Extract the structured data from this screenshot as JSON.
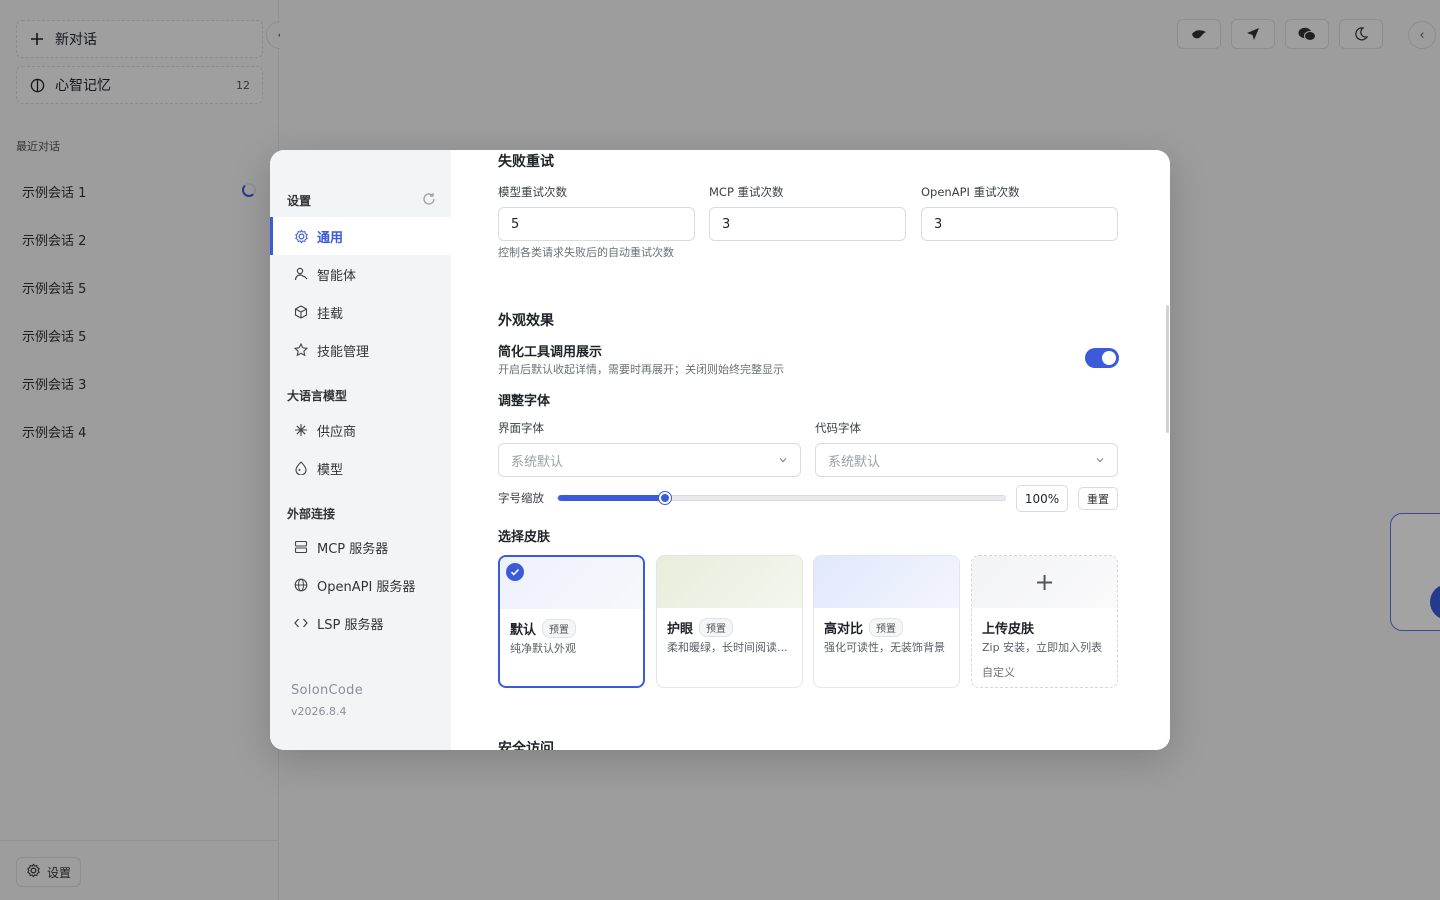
{
  "sidebar": {
    "new_chat": "新对话",
    "memory": "心智记忆",
    "memory_count": "12",
    "recent_title": "最近对话",
    "conversations": [
      "示例会话 1",
      "示例会话 2",
      "示例会话 5",
      "示例会话 5",
      "示例会话 3",
      "示例会话 4"
    ],
    "settings_label": "设置"
  },
  "modal": {
    "nav": {
      "settings_section": "设置",
      "items_general": [
        "通用",
        "智能体",
        "挂载",
        "技能管理"
      ],
      "llm_section": "大语言模型",
      "items_llm": [
        "供应商",
        "模型"
      ],
      "external_section": "外部连接",
      "items_external": [
        "MCP 服务器",
        "OpenAPI 服务器",
        "LSP 服务器"
      ],
      "brand": "SolonCode",
      "version": "v2026.8.4"
    },
    "retry": {
      "title": "失败重试",
      "model_label": "模型重试次数",
      "model_value": "5",
      "mcp_label": "MCP 重试次数",
      "mcp_value": "3",
      "openapi_label": "OpenAPI 重试次数",
      "openapi_value": "3",
      "hint": "控制各类请求失败后的自动重试次数"
    },
    "appearance": {
      "title": "外观效果",
      "simplify_label": "简化工具调用展示",
      "simplify_hint": "开启后默认收起详情，需要时再展开；关闭则始终完整显示",
      "simplify_on": true,
      "font_title": "调整字体",
      "ui_font_label": "界面字体",
      "ui_font_value": "系统默认",
      "code_font_label": "代码字体",
      "code_font_value": "系统默认",
      "scale_label": "字号缩放",
      "scale_value": "100%",
      "scale_fraction": 0.24,
      "reset_label": "重置"
    },
    "skins": {
      "title": "选择皮肤",
      "items": [
        {
          "name": "默认",
          "tag": "预置",
          "desc": "纯净默认外观",
          "selected": true
        },
        {
          "name": "护眼",
          "tag": "预置",
          "desc": "柔和暖绿，长时间阅读..."
        },
        {
          "name": "高对比",
          "tag": "预置",
          "desc": "强化可读性，无装饰背景"
        }
      ],
      "upload": {
        "name": "上传皮肤",
        "desc": "Zip 安装，立即加入列表",
        "extra": "自定义",
        "plus": "+"
      }
    },
    "security_title": "安全访问"
  }
}
